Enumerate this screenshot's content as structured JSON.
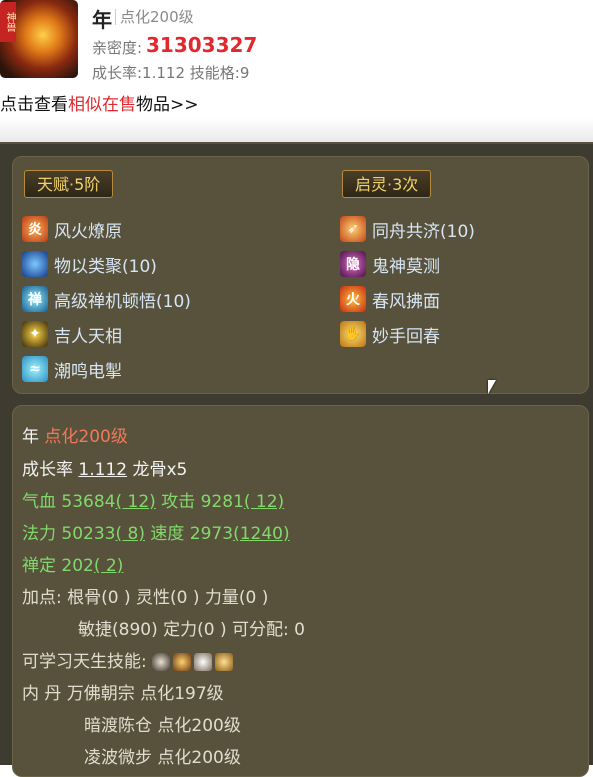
{
  "header": {
    "pet_name": "年",
    "pet_level": "点化200级",
    "avatar_tag": "神兽",
    "affinity_label": "亲密度:",
    "affinity_value": "31303327",
    "growth_line": "成长率:1.112  技能格:9",
    "link_prefix": "点击查看",
    "link_highlight": "相似在售",
    "link_suffix": "物品>>"
  },
  "talent": {
    "badge_left_title": "天赋",
    "badge_left_value": "5阶",
    "badge_right_title": "启灵",
    "badge_right_value": "3次",
    "left_skills": [
      {
        "label": "风火燎原",
        "icon": "flame-swirl-icon"
      },
      {
        "label": "物以类聚(10)",
        "icon": "blue-orb-icon"
      },
      {
        "label": "高级禅机顿悟(10)",
        "icon": "lotus-icon"
      },
      {
        "label": "吉人天相",
        "icon": "golden-star-icon"
      },
      {
        "label": "潮鸣电掣",
        "icon": "wave-icon"
      }
    ],
    "right_skills": [
      {
        "label": "同舟共济(10)",
        "icon": "fire-spear-icon"
      },
      {
        "label": "鬼神莫测",
        "icon": "hidden-glyph-icon"
      },
      {
        "label": "春风拂面",
        "icon": "fire-icon"
      },
      {
        "label": "妙手回春",
        "icon": "healing-hand-icon"
      }
    ]
  },
  "stats": {
    "name": "年",
    "level": "点化200级",
    "growth_label": "成长率",
    "growth_value": "1.112",
    "bone": "龙骨x5",
    "hp_label": "气血",
    "hp_value": "53684",
    "hp_bonus": "( 12)",
    "atk_label": "攻击",
    "atk_value": "9281",
    "atk_bonus": "( 12)",
    "mp_label": "法力",
    "mp_value": "50233",
    "mp_bonus": "( 8)",
    "spd_label": "速度",
    "spd_value": "2973",
    "spd_bonus": "(1240)",
    "zen_label": "禅定",
    "zen_value": "202",
    "zen_bonus": "( 2)",
    "points_line1": "加点:  根骨(0 ) 灵性(0 ) 力量(0 )",
    "points_line2": "敏捷(890) 定力(0 ) 可分配:  0",
    "innate_label": "可学习天生技能:",
    "inner_label": "内    丹",
    "inner_items": [
      "万佛朝宗 点化197级",
      "暗渡陈仓 点化200级",
      "凌波微步 点化200级"
    ]
  }
}
